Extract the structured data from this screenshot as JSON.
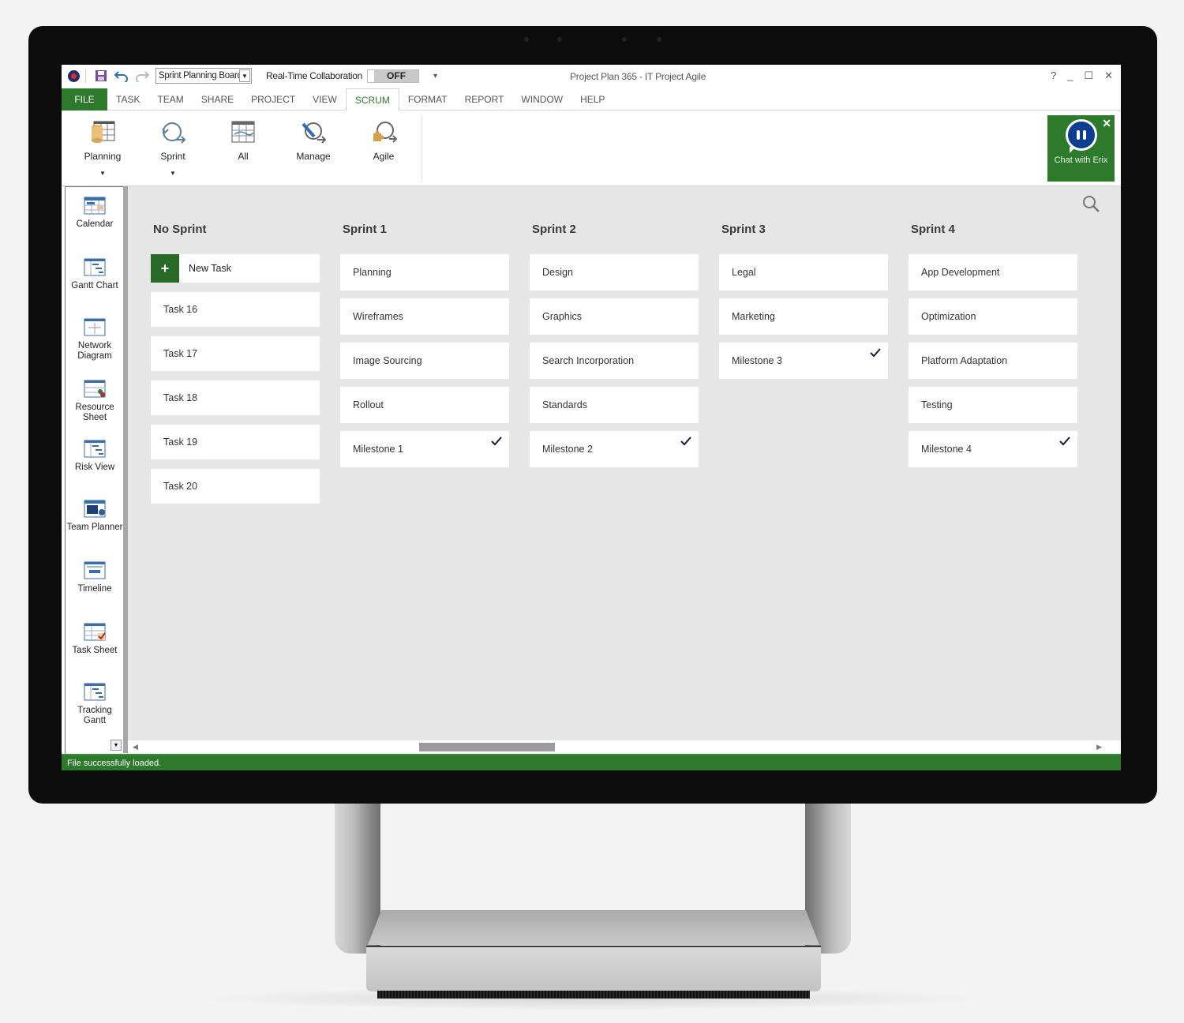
{
  "titlebar": {
    "view_selector_value": "Sprint Planning Board",
    "collab_label": "Real-Time Collaboration",
    "collab_toggle": "OFF",
    "window_title": "Project Plan 365 - IT Project Agile",
    "controls": {
      "help": "?",
      "minimize": "_",
      "maximize": "☐",
      "close": "✕"
    }
  },
  "menu": {
    "tabs": [
      "FILE",
      "TASK",
      "TEAM",
      "SHARE",
      "PROJECT",
      "VIEW",
      "SCRUM",
      "FORMAT",
      "REPORT",
      "WINDOW",
      "HELP"
    ],
    "active": "SCRUM"
  },
  "ribbon": {
    "buttons": [
      {
        "label": "Planning",
        "icon": "planning-board-icon",
        "has_dropdown": true
      },
      {
        "label": "Sprint",
        "icon": "sprint-cycle-icon",
        "has_dropdown": true
      },
      {
        "label": "All",
        "icon": "all-sprints-table-icon",
        "has_dropdown": false
      },
      {
        "label": "Manage",
        "icon": "manage-sprint-icon",
        "has_dropdown": false
      },
      {
        "label": "Agile",
        "icon": "agile-cycle-icon",
        "has_dropdown": false
      }
    ],
    "chat": {
      "label": "Chat with Erix",
      "close": "✕"
    }
  },
  "views": [
    {
      "label": "Calendar"
    },
    {
      "label": "Gantt Chart"
    },
    {
      "label": "Network Diagram"
    },
    {
      "label": "Resource Sheet"
    },
    {
      "label": "Risk View"
    },
    {
      "label": "Team Planner"
    },
    {
      "label": "Timeline"
    },
    {
      "label": "Task Sheet"
    },
    {
      "label": "Tracking Gantt"
    }
  ],
  "board": {
    "new_task_label": "New Task",
    "columns": [
      {
        "title": "No Sprint",
        "cards": [
          {
            "name": "Task 16",
            "done": false
          },
          {
            "name": "Task 17",
            "done": false
          },
          {
            "name": "Task 18",
            "done": false
          },
          {
            "name": "Task 19",
            "done": false
          },
          {
            "name": "Task 20",
            "done": false
          }
        ]
      },
      {
        "title": "Sprint 1",
        "cards": [
          {
            "name": "Planning",
            "done": false
          },
          {
            "name": "Wireframes",
            "done": false
          },
          {
            "name": "Image Sourcing",
            "done": false
          },
          {
            "name": "Rollout",
            "done": false
          },
          {
            "name": "Milestone 1",
            "done": true
          }
        ]
      },
      {
        "title": "Sprint 2",
        "cards": [
          {
            "name": "Design",
            "done": false
          },
          {
            "name": "Graphics",
            "done": false
          },
          {
            "name": "Search Incorporation",
            "done": false
          },
          {
            "name": "Standards",
            "done": false
          },
          {
            "name": "Milestone 2",
            "done": true
          }
        ]
      },
      {
        "title": "Sprint 3",
        "cards": [
          {
            "name": "Legal",
            "done": false
          },
          {
            "name": "Marketing",
            "done": false
          },
          {
            "name": "Milestone 3",
            "done": true
          }
        ]
      },
      {
        "title": "Sprint 4",
        "cards": [
          {
            "name": "App Development",
            "done": false
          },
          {
            "name": "Optimization",
            "done": false
          },
          {
            "name": "Platform Adaptation",
            "done": false
          },
          {
            "name": "Testing",
            "done": false
          },
          {
            "name": "Milestone 4",
            "done": true
          }
        ]
      }
    ]
  },
  "status": {
    "message": "File successfully loaded."
  },
  "colors": {
    "accent_green": "#2d7a2d",
    "chat_blue": "#0d3d91",
    "board_bg": "#e6e6e6"
  }
}
